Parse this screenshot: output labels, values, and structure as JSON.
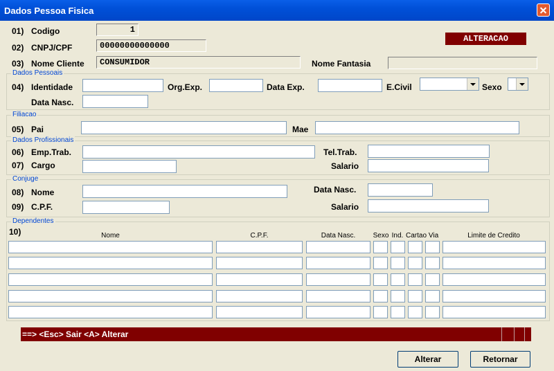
{
  "window": {
    "title": "Dados Pessoa Fisica"
  },
  "mode_badge": "ALTERACAO",
  "fields": {
    "codigo": {
      "num": "01)",
      "label": "Codigo",
      "value": "1"
    },
    "cnpj": {
      "num": "02)",
      "label": "CNPJ/CPF",
      "value": "00000000000000"
    },
    "nome_cliente": {
      "num": "03)",
      "label": "Nome Cliente",
      "value": "CONSUMIDOR"
    },
    "nome_fantasia": {
      "label": "Nome Fantasia",
      "value": ""
    }
  },
  "dados_pessoais": {
    "title": "Dados Pessoais",
    "num": "04)",
    "identidade": "Identidade",
    "org_exp": "Org.Exp.",
    "data_exp": "Data Exp.",
    "e_civil": "E.Civil",
    "sexo": "Sexo",
    "data_nasc": "Data Nasc."
  },
  "filiacao": {
    "title": "Filiacao",
    "num": "05)",
    "pai": "Pai",
    "mae": "Mae"
  },
  "dados_profissionais": {
    "title": "Dados Profissionais",
    "num6": "06)",
    "emp_trab": "Emp.Trab.",
    "tel_trab": "Tel.Trab.",
    "num7": "07)",
    "cargo": "Cargo",
    "salario": "Salario"
  },
  "conjuge": {
    "title": "Conjuge",
    "num8": "08)",
    "nome": "Nome",
    "data_nasc": "Data Nasc.",
    "num9": "09)",
    "cpf": "C.P.F.",
    "salario": "Salario"
  },
  "dependentes": {
    "title": "Dependentes",
    "num": "10)",
    "headers": {
      "nome": "Nome",
      "cpf": "C.P.F.",
      "data_nasc": "Data Nasc.",
      "sexo": "Sexo",
      "ind": "Ind.",
      "cartao": "Cartao",
      "via": "Via",
      "limite": "Limite de Credito"
    }
  },
  "status": {
    "text": "==> <Esc> Sair  <A> Alterar",
    "bar_color": "#800000"
  },
  "buttons": {
    "alterar": "Alterar",
    "retornar": "Retornar"
  }
}
